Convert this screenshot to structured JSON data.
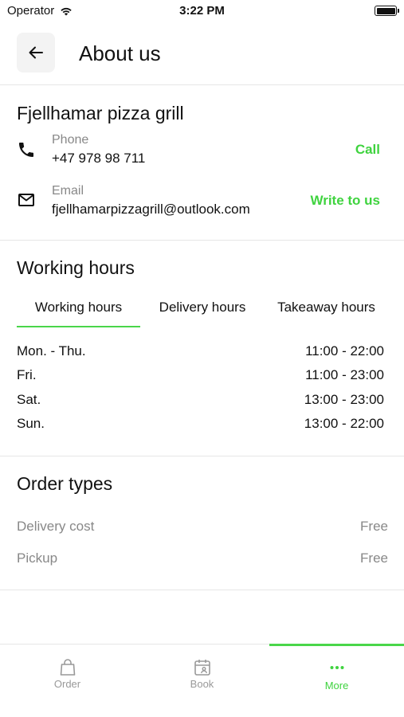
{
  "status_bar": {
    "carrier": "Operator",
    "time": "3:22 PM"
  },
  "header": {
    "title": "About us"
  },
  "restaurant": {
    "name": "Fjellhamar pizza grill",
    "phone": {
      "label": "Phone",
      "value": "+47 978 98 711",
      "action": "Call"
    },
    "email": {
      "label": "Email",
      "value": "fjellhamarpizzagrill@outlook.com",
      "action": "Write to us"
    }
  },
  "working_hours": {
    "title": "Working hours",
    "tabs": [
      {
        "label": "Working hours",
        "active": true
      },
      {
        "label": "Delivery hours",
        "active": false
      },
      {
        "label": "Takeaway hours",
        "active": false
      }
    ],
    "rows": [
      {
        "day": "Mon. - Thu.",
        "time": "11:00 - 22:00"
      },
      {
        "day": "Fri.",
        "time": "11:00 - 23:00"
      },
      {
        "day": "Sat.",
        "time": "13:00 - 23:00"
      },
      {
        "day": "Sun.",
        "time": "13:00 - 22:00"
      }
    ]
  },
  "order_types": {
    "title": "Order types",
    "rows": [
      {
        "label": "Delivery cost",
        "value": "Free"
      },
      {
        "label": "Pickup",
        "value": "Free"
      }
    ]
  },
  "bottom_nav": {
    "items": [
      {
        "label": "Order",
        "icon": "bag-icon",
        "active": false
      },
      {
        "label": "Book",
        "icon": "calendar-icon",
        "active": false
      },
      {
        "label": "More",
        "icon": "more-dots-icon",
        "active": true
      }
    ]
  },
  "colors": {
    "accent": "#3fd33f",
    "muted_text": "#888888",
    "divider": "#e6e6e6"
  }
}
